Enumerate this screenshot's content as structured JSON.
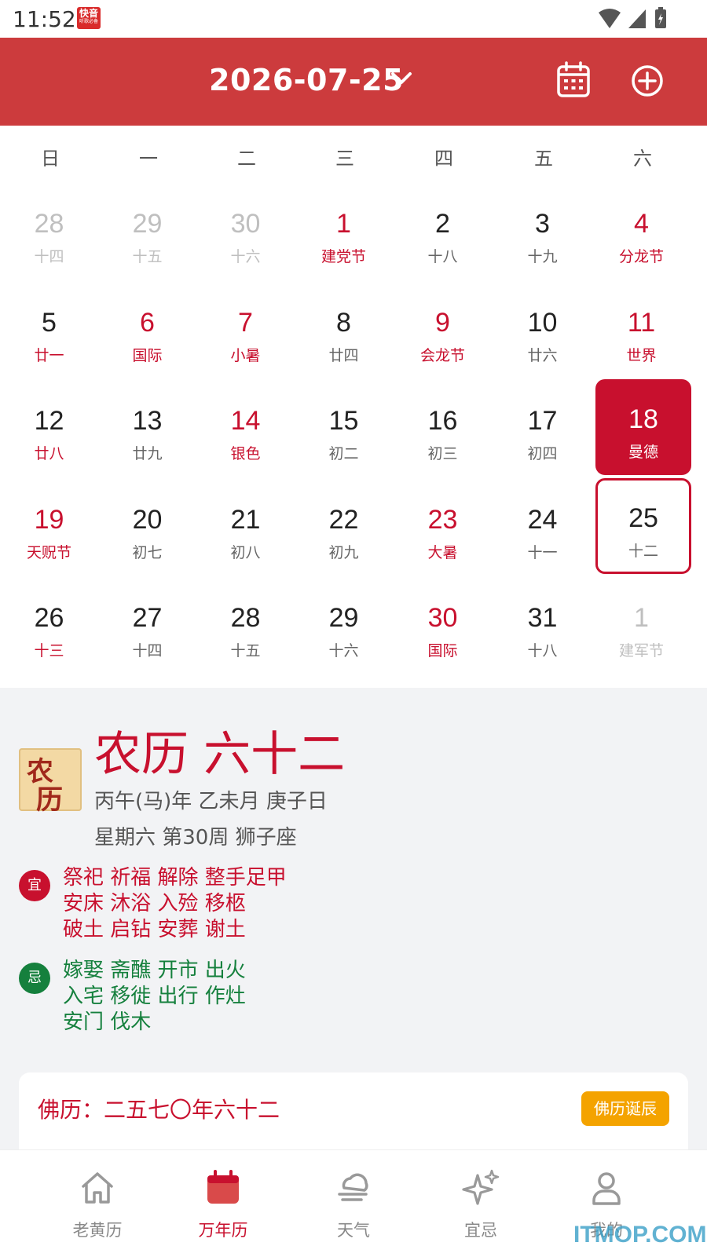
{
  "status_bar": {
    "time": "11:52",
    "app_badge": "快音",
    "app_badge_sub": "听歌必备"
  },
  "header": {
    "date": "2026-07-25"
  },
  "weekdays": [
    "日",
    "一",
    "二",
    "三",
    "四",
    "五",
    "六"
  ],
  "calendar": {
    "rows": [
      [
        {
          "day": "28",
          "sub": "十四",
          "style": "muted"
        },
        {
          "day": "29",
          "sub": "十五",
          "style": "muted"
        },
        {
          "day": "30",
          "sub": "十六",
          "style": "muted"
        },
        {
          "day": "1",
          "sub": "建党节",
          "style": "red"
        },
        {
          "day": "2",
          "sub": "十八",
          "style": "normal"
        },
        {
          "day": "3",
          "sub": "十九",
          "style": "normal"
        },
        {
          "day": "4",
          "sub": "分龙节",
          "style": "red"
        }
      ],
      [
        {
          "day": "5",
          "sub": "廿一",
          "style": "subred"
        },
        {
          "day": "6",
          "sub": "国际",
          "style": "red"
        },
        {
          "day": "7",
          "sub": "小暑",
          "style": "red"
        },
        {
          "day": "8",
          "sub": "廿四",
          "style": "normal"
        },
        {
          "day": "9",
          "sub": "会龙节",
          "style": "red"
        },
        {
          "day": "10",
          "sub": "廿六",
          "style": "normal"
        },
        {
          "day": "11",
          "sub": "世界",
          "style": "red"
        }
      ],
      [
        {
          "day": "12",
          "sub": "廿八",
          "style": "subred"
        },
        {
          "day": "13",
          "sub": "廿九",
          "style": "normal"
        },
        {
          "day": "14",
          "sub": "银色",
          "style": "red"
        },
        {
          "day": "15",
          "sub": "初二",
          "style": "normal"
        },
        {
          "day": "16",
          "sub": "初三",
          "style": "normal"
        },
        {
          "day": "17",
          "sub": "初四",
          "style": "normal"
        },
        {
          "day": "18",
          "sub": "曼德",
          "style": "selected"
        }
      ],
      [
        {
          "day": "19",
          "sub": "天贶节",
          "style": "red"
        },
        {
          "day": "20",
          "sub": "初七",
          "style": "normal"
        },
        {
          "day": "21",
          "sub": "初八",
          "style": "normal"
        },
        {
          "day": "22",
          "sub": "初九",
          "style": "normal"
        },
        {
          "day": "23",
          "sub": "大暑",
          "style": "red"
        },
        {
          "day": "24",
          "sub": "十一",
          "style": "normal"
        },
        {
          "day": "25",
          "sub": "十二",
          "style": "today"
        }
      ],
      [
        {
          "day": "26",
          "sub": "十三",
          "style": "subred"
        },
        {
          "day": "27",
          "sub": "十四",
          "style": "normal"
        },
        {
          "day": "28",
          "sub": "十五",
          "style": "normal"
        },
        {
          "day": "29",
          "sub": "十六",
          "style": "normal"
        },
        {
          "day": "30",
          "sub": "国际",
          "style": "red"
        },
        {
          "day": "31",
          "sub": "十八",
          "style": "normal"
        },
        {
          "day": "1",
          "sub": "建军节",
          "style": "muted"
        }
      ]
    ]
  },
  "lunar": {
    "icon_chars": [
      "农",
      "历"
    ],
    "title": "农历 六十二",
    "line1": "丙午(马)年 乙未月 庚子日",
    "line2": "星期六 第30周 狮子座"
  },
  "yi": {
    "badge": "宜",
    "lines": [
      "祭祀 祈福 解除 整手足甲",
      "安床 沐浴 入殓 移柩",
      "破土 启钻 安葬 谢土"
    ]
  },
  "ji": {
    "badge": "忌",
    "lines": [
      "嫁娶 斋醮 开市 出火",
      "入宅 移徙 出行 作灶",
      "安门 伐木"
    ]
  },
  "buddhist": {
    "text": "佛历：二五七〇年六十二",
    "button": "佛历诞辰"
  },
  "bottom_nav": [
    {
      "label": "老黄历",
      "icon": "home-icon",
      "active": false
    },
    {
      "label": "万年历",
      "icon": "calendar-icon",
      "active": true
    },
    {
      "label": "天气",
      "icon": "weather-icon",
      "active": false
    },
    {
      "label": "宜忌",
      "icon": "sparkle-icon",
      "active": false
    },
    {
      "label": "我的",
      "icon": "user-icon",
      "active": false
    }
  ],
  "watermark": "ITMOP.COM",
  "colors": {
    "header_red": "#cc3b3d",
    "accent_red": "#c8102e",
    "green": "#15803d",
    "orange": "#f4a300"
  }
}
